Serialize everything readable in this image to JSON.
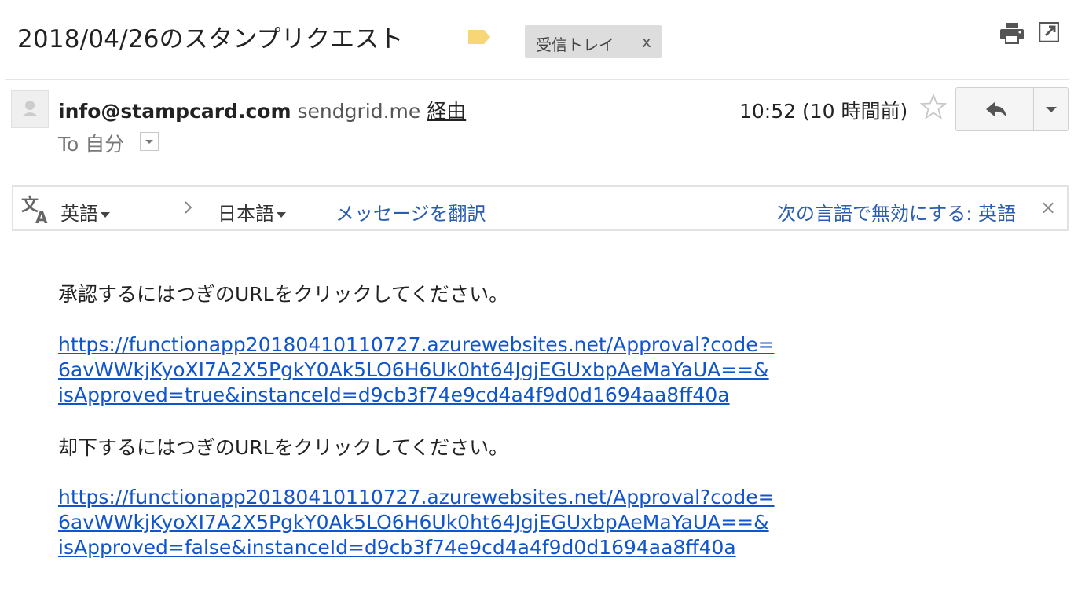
{
  "subject": {
    "title": "2018/04/26のスタンプリクエスト",
    "label_color": "#f7d775",
    "inbox_label": "受信トレイ",
    "inbox_remove": "x"
  },
  "toolbar": {
    "print_icon": "print-icon",
    "popout_icon": "open-in-new-window-icon"
  },
  "header": {
    "from": "info@stampcard.com",
    "via_domain": "sendgrid.me",
    "via_label": "経由",
    "to": "To 自分",
    "time": "10:52 (10 時間前)"
  },
  "translate_bar": {
    "source_lang": "英語",
    "target_lang": "日本語",
    "translate_link": "メッセージを翻訳",
    "disable_link": "次の言語で無効にする: 英語",
    "close": "×"
  },
  "body": {
    "approve_text": "承認するにはつぎのURLをクリックしてください。",
    "approve_url": [
      "https://functionapp20180410110727.azurewebsites.net/Approval?code=",
      "6avWWkjKyoXI7A2X5PgkY0Ak5LO6H6Uk0ht64JgjEGUxbpAeMaYaUA==&",
      "isApproved=true&instanceId=d9cb3f74e9cd4a4f9d0d1694aa8ff40a"
    ],
    "reject_text": "却下するにはつぎのURLをクリックしてください。",
    "reject_url": [
      "https://functionapp20180410110727.azurewebsites.net/Approval?code=",
      "6avWWkjKyoXI7A2X5PgkY0Ak5LO6H6Uk0ht64JgjEGUxbpAeMaYaUA==&",
      "isApproved=false&instanceId=d9cb3f74e9cd4a4f9d0d1694aa8ff40a"
    ]
  },
  "colors": {
    "link": "#1155cc",
    "translate_link": "#2a5db0",
    "chip_bg": "#dddddd"
  }
}
